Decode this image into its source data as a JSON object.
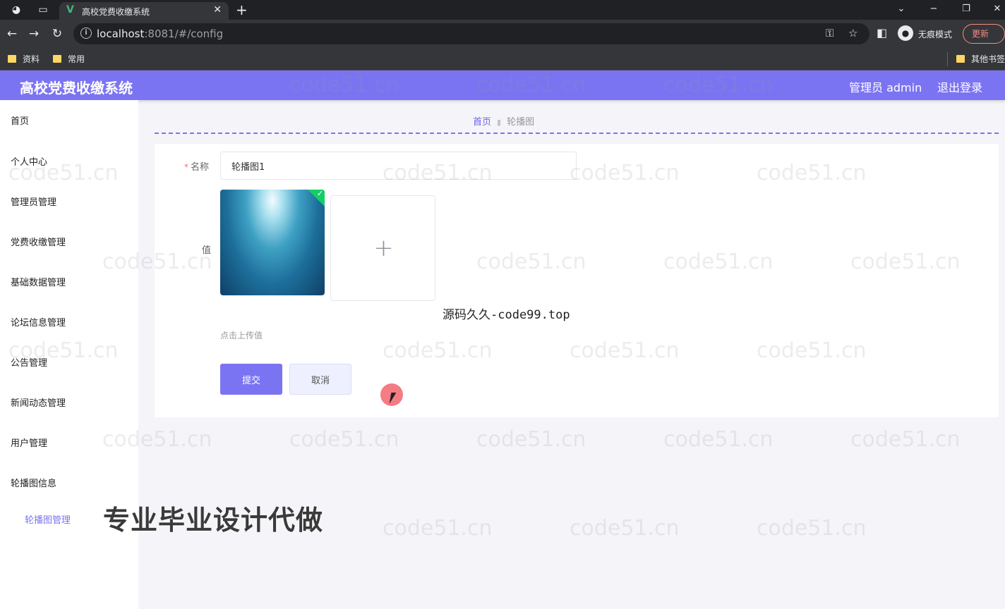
{
  "browser": {
    "tab_title": "高校党费收缴系统",
    "url_host": "localhost",
    "url_rest": ":8081/#/config",
    "incognito_label": "无痕模式",
    "update_label": "更新",
    "bookmarks": [
      "资料",
      "常用"
    ],
    "other_bookmarks": "其他书签"
  },
  "header": {
    "app_title": "高校党费收缴系统",
    "admin_label": "管理员 admin",
    "logout_label": "退出登录"
  },
  "sidebar": {
    "items": [
      {
        "label": "首页"
      },
      {
        "label": "个人中心"
      },
      {
        "label": "管理员管理"
      },
      {
        "label": "党费收缴管理"
      },
      {
        "label": "基础数据管理"
      },
      {
        "label": "论坛信息管理"
      },
      {
        "label": "公告管理"
      },
      {
        "label": "新闻动态管理"
      },
      {
        "label": "用户管理"
      },
      {
        "label": "轮播图信息"
      }
    ],
    "submenu_active": "轮播图管理"
  },
  "breadcrumb": {
    "home": "首页",
    "current": "轮播图"
  },
  "form": {
    "name_label": "名称",
    "name_value": "轮播图1",
    "value_label": "值",
    "upload_tip": "点击上传值",
    "submit_label": "提交",
    "cancel_label": "取消"
  },
  "overlays": {
    "source_watermark": "源码久久-code99.top",
    "promo_text": "专业毕业设计代做",
    "repeat_watermark": "code51.cn"
  },
  "colors": {
    "accent": "#7b74f2",
    "header_bg": "#7b74f2",
    "page_bg": "#f5f5f9"
  }
}
